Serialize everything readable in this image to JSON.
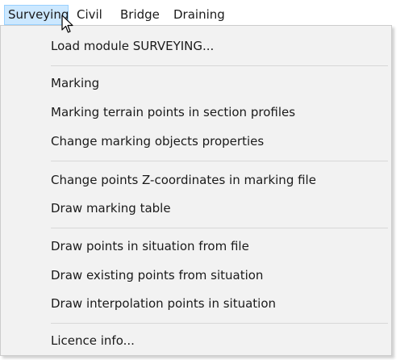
{
  "menubar": {
    "items": [
      {
        "label": "Surveying"
      },
      {
        "label": "Civil"
      },
      {
        "label": "Bridge"
      },
      {
        "label": "Draining"
      }
    ]
  },
  "menu": {
    "items": [
      {
        "label": "Load module SURVEYING..."
      },
      {
        "label": "Marking"
      },
      {
        "label": "Marking terrain points in section profiles"
      },
      {
        "label": "Change marking objects properties"
      },
      {
        "label": "Change points Z-coordinates in marking file"
      },
      {
        "label": "Draw marking table"
      },
      {
        "label": "Draw points in situation from file"
      },
      {
        "label": "Draw existing points from situation"
      },
      {
        "label": "Draw interpolation points in situation"
      },
      {
        "label": "Licence info..."
      }
    ]
  },
  "colors": {
    "menu_background": "#f2f2f2",
    "active_highlight": "#cce8ff",
    "active_border": "#99d1ff",
    "separator": "#d7d7d7"
  }
}
